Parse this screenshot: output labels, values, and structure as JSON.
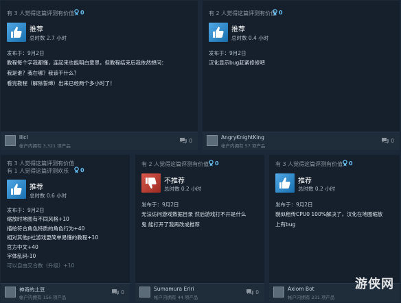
{
  "reviews": [
    {
      "helpful": [
        "有 3 人觉得这篇评测有价值"
      ],
      "awards": "0",
      "verdict": "推荐",
      "hours": "总时数 2.7 小时",
      "posted": "发布于：9月2日",
      "lines": [
        "教程每个字我都懂，连起来也能明白意思，但教程结束后我依然想问：",
        "我是谁？我在哪？我该干什么？",
        "看完教程（解除誓缔）出来已经两个多小时了！"
      ],
      "user": "lllcl",
      "products": "帐户内拥有 3,321 项产品",
      "comments": "0",
      "type": "up"
    },
    {
      "helpful": [
        "有 2 人觉得这篇评测有价值"
      ],
      "awards": "0",
      "verdict": "推荐",
      "hours": "总时数 0.4 小时",
      "posted": "发布于：9月2日",
      "lines": [
        "汉化显示bug赶紧修修吧"
      ],
      "user": "AngryKnightKing",
      "products": "帐户内拥有 57 项产品",
      "comments": "0",
      "type": "up"
    },
    {
      "helpful": [
        "有 3 人觉得这篇评测有价值",
        "有 1 人觉得这篇评测欢乐"
      ],
      "awards": "0",
      "verdict": "推荐",
      "hours": "总时数 0.6 小时",
      "posted": "发布于：9月2日",
      "lines": [
        "缩放时地图有不同风格+10",
        "描绘符合角色特质的角色行为+40",
        "相对其他p社游戏更简单易懂的教程+10",
        "官方中文+40",
        "字体乱码-10",
        "可以自由交合数（升级）+10"
      ],
      "user": "神奇的土豆",
      "products": "帐户内拥有 156 项产品",
      "comments": "0",
      "type": "up"
    },
    {
      "helpful": [
        "有 2 人觉得这篇评测有价值"
      ],
      "awards": "0",
      "verdict": "不推荐",
      "hours": "总时数 0.2 小时",
      "posted": "发布于：9月2日",
      "lines": [
        "无法访问游戏数据目录 然后游戏打不开是什么",
        "鬼 能打开了我再改成推荐"
      ],
      "user": "Sumamura Eriri",
      "products": "帐户内拥有 44 项产品",
      "comments": "0",
      "type": "down"
    },
    {
      "helpful": [
        "有 3 人觉得这篇评测有价值"
      ],
      "awards": "0",
      "verdict": "推荐",
      "hours": "总时数 0.2 小时",
      "posted": "发布于：9月2日",
      "lines": [
        "貌似租传CPU0 100%解决了，汉化在地图缩放",
        "上有bug"
      ],
      "user": "Axiom Bot",
      "products": "帐户内拥有 231 项产品",
      "comments": "0",
      "type": "up"
    }
  ],
  "watermark": "游侠网",
  "colors": {
    "page_bg": "#1b2838",
    "card_bg": "#16202d",
    "accent": "#66c0f4",
    "thumb_up": "#3d8fd1",
    "thumb_down": "#c4392e"
  },
  "icons": {
    "award": "award-ribbon-icon",
    "thumb_up": "thumbs-up-icon",
    "thumb_down": "thumbs-down-icon",
    "comment": "comment-bubble-icon"
  }
}
